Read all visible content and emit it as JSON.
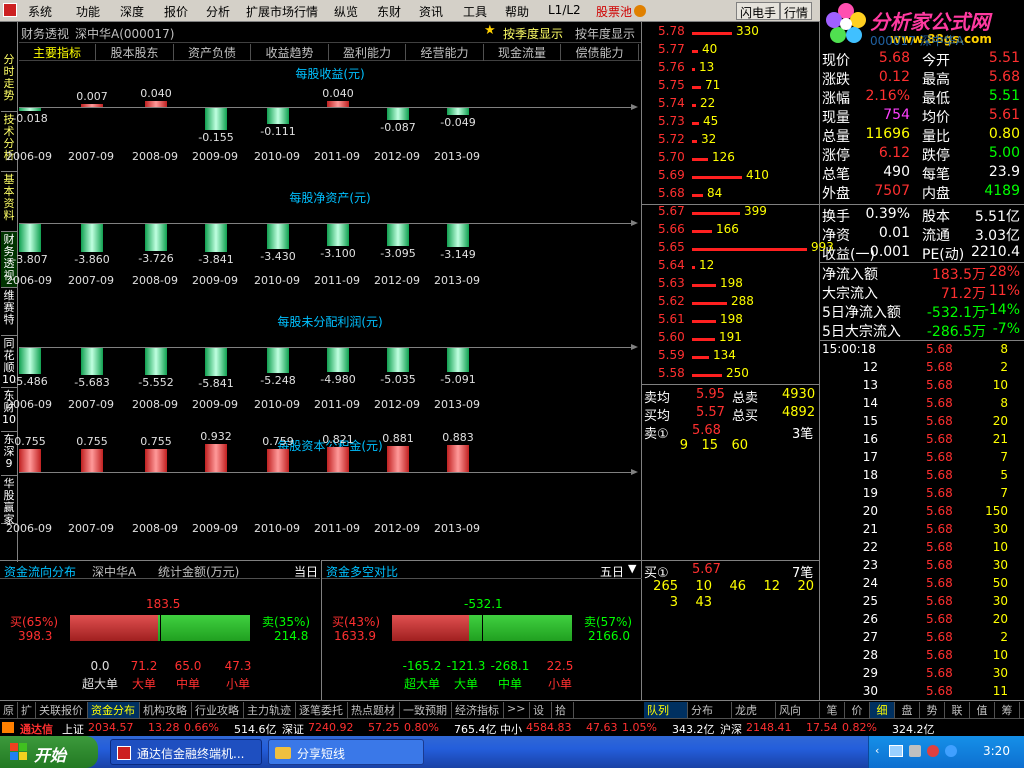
{
  "menu": {
    "items": [
      "系统",
      "功能",
      "深度",
      "报价",
      "分析",
      "扩展市场行情",
      "纵览",
      "东财",
      "资讯",
      "工具",
      "帮助",
      "L1/L2"
    ],
    "gupiaochi": "股票池",
    "flash": "闪电手",
    "quotes": "行情"
  },
  "logo": {
    "title": "分析家公式网",
    "url": "www.88gs.com",
    "behind_text": "000017 深中华A"
  },
  "vtabs": [
    "分时走势",
    "技术分析",
    "基本资料",
    "财务透视",
    "维赛特",
    "同花顺10",
    "东财10",
    "东深9",
    "华股赢家"
  ],
  "fin": {
    "title": "财务透视",
    "stock": "深中华A(000017)",
    "by_quarter": "按季度显示",
    "by_year": "按年度显示",
    "tabs": [
      "主要指标",
      "股本股东",
      "资产负债",
      "收益趋势",
      "盈利能力",
      "经营能力",
      "现金流量",
      "偿债能力"
    ]
  },
  "charts": [
    {
      "title": "每股收益(元)",
      "years": [
        "2006-09",
        "2007-09",
        "2008-09",
        "2009-09",
        "2010-09",
        "2011-09",
        "2012-09",
        "2013-09"
      ],
      "values": [
        -0.018,
        0.007,
        0.04,
        -0.155,
        -0.111,
        0.04,
        -0.087,
        -0.049
      ],
      "labels": [
        "-0.018",
        "0.007",
        "0.040",
        "-0.155",
        "-0.111",
        "0.040",
        "-0.087",
        "-0.049"
      ]
    },
    {
      "title": "每股净资产(元)",
      "years": [
        "2006-09",
        "2007-09",
        "2008-09",
        "2009-09",
        "2010-09",
        "2011-09",
        "2012-09",
        "2013-09"
      ],
      "values": [
        -3.807,
        -3.86,
        -3.726,
        -3.841,
        -3.43,
        -3.1,
        -3.095,
        -3.149
      ],
      "labels": [
        "-3.807",
        "-3.860",
        "-3.726",
        "-3.841",
        "-3.430",
        "-3.100",
        "-3.095",
        "-3.149"
      ]
    },
    {
      "title": "每股未分配利润(元)",
      "years": [
        "2006-09",
        "2007-09",
        "2008-09",
        "2009-09",
        "2010-09",
        "2011-09",
        "2012-09",
        "2013-09"
      ],
      "values": [
        -5.486,
        -5.683,
        -5.552,
        -5.841,
        -5.248,
        -4.98,
        -5.035,
        -5.091
      ],
      "labels": [
        "-5.486",
        "-5.683",
        "-5.552",
        "-5.841",
        "-5.248",
        "-4.980",
        "-5.035",
        "-5.091"
      ]
    },
    {
      "title": "每股资本公积金(元)",
      "years": [
        "2006-09",
        "2007-09",
        "2008-09",
        "2009-09",
        "2010-09",
        "2011-09",
        "2012-09",
        "2013-09"
      ],
      "values": [
        0.755,
        0.755,
        0.755,
        0.932,
        0.759,
        0.821,
        0.881,
        0.883
      ],
      "labels": [
        "0.755",
        "0.755",
        "0.755",
        "0.932",
        "0.759",
        "0.821",
        "0.881",
        "0.883"
      ]
    }
  ],
  "flow_left": {
    "title": "资金流向分布",
    "stock": "深中华A",
    "unit": "统计金额(万元)",
    "period": "当日",
    "buy_pct": "买(65%)",
    "buy_val": "398.3",
    "sell_pct": "卖(35%)",
    "sell_val": "214.8",
    "center": "183.5",
    "buy_frac": 0.65,
    "cats": [
      {
        "val": "0.0",
        "label": "超大单"
      },
      {
        "val": "71.2",
        "label": "大单"
      },
      {
        "val": "65.0",
        "label": "中单"
      },
      {
        "val": "47.3",
        "label": "小单"
      }
    ]
  },
  "flow_right": {
    "title": "资金多空对比",
    "period": "五日",
    "buy_pct": "买(43%)",
    "buy_val": "1633.9",
    "sell_pct": "卖(57%)",
    "sell_val": "2166.0",
    "center": "-532.1",
    "buy_frac": 0.43,
    "cats": [
      {
        "val": "-165.2",
        "label": "超大单"
      },
      {
        "val": "-121.3",
        "label": "大单"
      },
      {
        "val": "-268.1",
        "label": "中单"
      },
      {
        "val": "22.5",
        "label": "小单"
      }
    ]
  },
  "orderbook": {
    "asks": [
      {
        "p": "5.78",
        "v": "330",
        "w": 40
      },
      {
        "p": "5.77",
        "v": "40",
        "w": 6
      },
      {
        "p": "5.76",
        "v": "13",
        "w": 3
      },
      {
        "p": "5.75",
        "v": "71",
        "w": 9
      },
      {
        "p": "5.74",
        "v": "22",
        "w": 4
      },
      {
        "p": "5.73",
        "v": "45",
        "w": 7
      },
      {
        "p": "5.72",
        "v": "32",
        "w": 5
      },
      {
        "p": "5.70",
        "v": "126",
        "w": 16
      },
      {
        "p": "5.69",
        "v": "410",
        "w": 50
      },
      {
        "p": "5.68",
        "v": "84",
        "w": 11
      }
    ],
    "bids": [
      {
        "p": "5.67",
        "v": "399",
        "w": 48
      },
      {
        "p": "5.66",
        "v": "166",
        "w": 20
      },
      {
        "p": "5.65",
        "v": "993",
        "w": 115
      },
      {
        "p": "5.64",
        "v": "12",
        "w": 3
      },
      {
        "p": "5.63",
        "v": "198",
        "w": 24
      },
      {
        "p": "5.62",
        "v": "288",
        "w": 35
      },
      {
        "p": "5.61",
        "v": "198",
        "w": 24
      },
      {
        "p": "5.60",
        "v": "191",
        "w": 23
      },
      {
        "p": "5.59",
        "v": "134",
        "w": 17
      },
      {
        "p": "5.58",
        "v": "250",
        "w": 30
      }
    ],
    "sell_avg_label": "卖均",
    "sell_avg": "5.95",
    "sell_total_label": "总卖",
    "sell_total": "4930",
    "buy_avg_label": "买均",
    "buy_avg": "5.57",
    "buy_total_label": "总买",
    "buy_total": "4892",
    "ask1_label": "卖①",
    "ask1_price": "5.68",
    "ask1_count": "3笔",
    "ask1_queue": [
      "9",
      "15",
      "60"
    ],
    "bid1_label": "买①",
    "bid1_price": "5.67",
    "bid1_count": "7笔",
    "bid1_queue": [
      "265",
      "10",
      "46",
      "12",
      "20",
      "3",
      "43"
    ]
  },
  "quote": {
    "rows": [
      {
        "l": "现价",
        "v": "5.68",
        "vc": "red",
        "l2": "今开",
        "v2": "5.51",
        "v2c": "red"
      },
      {
        "l": "涨跌",
        "v": "0.12",
        "vc": "red",
        "l2": "最高",
        "v2": "5.68",
        "v2c": "red"
      },
      {
        "l": "涨幅",
        "v": "2.16%",
        "vc": "red",
        "l2": "最低",
        "v2": "5.51",
        "v2c": "green"
      },
      {
        "l": "现量",
        "v": "754",
        "vc": "purple",
        "l2": "均价",
        "v2": "5.61",
        "v2c": "red"
      },
      {
        "l": "总量",
        "v": "11696",
        "vc": "yellow",
        "l2": "量比",
        "v2": "0.80",
        "v2c": "yellow"
      },
      {
        "l": "涨停",
        "v": "6.12",
        "vc": "red",
        "l2": "跌停",
        "v2": "5.00",
        "v2c": "green"
      },
      {
        "l": "总笔",
        "v": "490",
        "vc": "white",
        "l2": "每笔",
        "v2": "23.9",
        "v2c": "white"
      },
      {
        "l": "外盘",
        "v": "7507",
        "vc": "red",
        "l2": "内盘",
        "v2": "4189",
        "v2c": "green"
      }
    ],
    "rows2": [
      {
        "l": "换手",
        "v": "0.39%",
        "vc": "white",
        "l2": "股本",
        "v2": "5.51亿",
        "v2c": "white"
      },
      {
        "l": "净资",
        "v": "0.01",
        "vc": "white",
        "l2": "流通",
        "v2": "3.03亿",
        "v2c": "white"
      },
      {
        "l": "收益(一)",
        "v": "0.001",
        "vc": "white",
        "l2": "PE(动)",
        "v2": "2210.4",
        "v2c": "white"
      }
    ],
    "flows": [
      {
        "l": "净流入额",
        "v": "183.5万",
        "p": "28%",
        "c": "red"
      },
      {
        "l": "大宗流入",
        "v": "71.2万",
        "p": "11%",
        "c": "red"
      },
      {
        "l": "5日净流入额",
        "v": "-532.1万",
        "p": "-14%",
        "c": "green"
      },
      {
        "l": "5日大宗流入",
        "v": "-286.5万",
        "p": "-7%",
        "c": "green"
      }
    ]
  },
  "ticks": [
    {
      "t": "15:00:18",
      "p": "5.68",
      "v": "8"
    },
    {
      "t": "12",
      "p": "5.68",
      "v": "2"
    },
    {
      "t": "13",
      "p": "5.68",
      "v": "10"
    },
    {
      "t": "14",
      "p": "5.68",
      "v": "8"
    },
    {
      "t": "15",
      "p": "5.68",
      "v": "20"
    },
    {
      "t": "16",
      "p": "5.68",
      "v": "21"
    },
    {
      "t": "17",
      "p": "5.68",
      "v": "7"
    },
    {
      "t": "18",
      "p": "5.68",
      "v": "5"
    },
    {
      "t": "19",
      "p": "5.68",
      "v": "7"
    },
    {
      "t": "20",
      "p": "5.68",
      "v": "150"
    },
    {
      "t": "21",
      "p": "5.68",
      "v": "30"
    },
    {
      "t": "22",
      "p": "5.68",
      "v": "10"
    },
    {
      "t": "23",
      "p": "5.68",
      "v": "30"
    },
    {
      "t": "24",
      "p": "5.68",
      "v": "50"
    },
    {
      "t": "25",
      "p": "5.68",
      "v": "30"
    },
    {
      "t": "26",
      "p": "5.68",
      "v": "20"
    },
    {
      "t": "27",
      "p": "5.68",
      "v": "2"
    },
    {
      "t": "28",
      "p": "5.68",
      "v": "10"
    },
    {
      "t": "29",
      "p": "5.68",
      "v": "30"
    },
    {
      "t": "30",
      "p": "5.68",
      "v": "11"
    }
  ],
  "bottom_tabs": [
    "原",
    "扩",
    "关联报价",
    "资金分布",
    "机构攻略",
    "行业攻略",
    "主力轨迹",
    "逐笔委托",
    "热点题材",
    "一致预期",
    "经济指标",
    ">>",
    "设",
    "拾"
  ],
  "bottom_tabs_mid": [
    "队列",
    "分布",
    "龙虎",
    "风向"
  ],
  "bottom_tabs_right": [
    "笔",
    "价",
    "细",
    "盘",
    "势",
    "联",
    "值",
    "筹"
  ],
  "ticker": {
    "brand": "通达信",
    "items": [
      {
        "name": "上证",
        "val": "2034.57",
        "chg": "13.28",
        "pct": "0.66%",
        "amt": "514.6亿"
      },
      {
        "name": "深证",
        "val": "7240.92",
        "chg": "57.25",
        "pct": "0.80%",
        "amt": "765.4亿"
      },
      {
        "name": "中小",
        "val": "4584.83",
        "chg": "47.63",
        "pct": "1.05%",
        "amt": "343.2亿"
      },
      {
        "name": "沪深",
        "val": "2148.41",
        "chg": "17.54",
        "pct": "0.82%",
        "amt": "324.2亿"
      }
    ]
  },
  "taskbar": {
    "start": "开始",
    "tasks": [
      "通达信金融终端机...",
      "分享短线"
    ],
    "clock": "3:20"
  }
}
